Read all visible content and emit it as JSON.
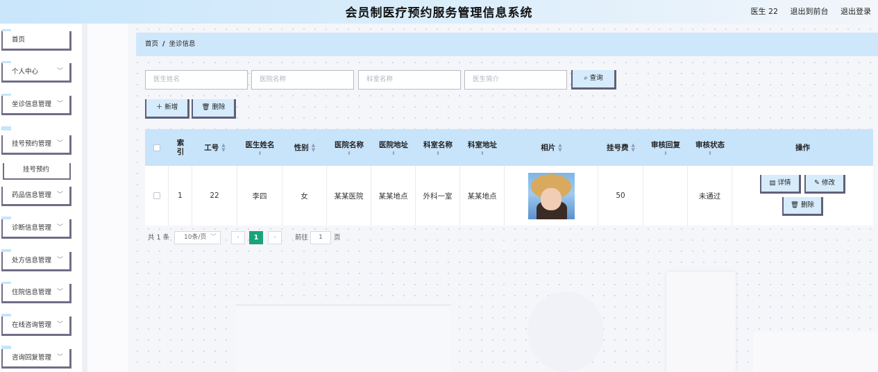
{
  "header": {
    "title": "会员制医疗预约服务管理信息系统",
    "user": "医生 22",
    "back_to_front": "退出到前台",
    "logout": "退出登录"
  },
  "sidebar": {
    "items": [
      {
        "label": "首页"
      },
      {
        "label": "个人中心"
      },
      {
        "label": "坐诊信息管理"
      },
      {
        "label": "挂号预约管理"
      },
      {
        "label": "药品信息管理"
      },
      {
        "label": "诊断信息管理"
      },
      {
        "label": "处方信息管理"
      },
      {
        "label": "住院信息管理"
      },
      {
        "label": "在线咨询管理"
      },
      {
        "label": "咨询回复管理"
      }
    ],
    "subitem": "挂号预约"
  },
  "breadcrumb": {
    "home": "首页",
    "separator": "/",
    "current": "坐诊信息"
  },
  "search": {
    "doctor_name_placeholder": "医生姓名",
    "hospital_name_placeholder": "医院名称",
    "department_name_placeholder": "科室名称",
    "doctor_intro_placeholder": "医生简介",
    "query_label": "查询"
  },
  "actions": {
    "add_label": "新增",
    "delete_label": "删除"
  },
  "table": {
    "headers": {
      "index": "索\n引",
      "job_no": "工号",
      "doctor_name": "医生姓名",
      "gender": "性别",
      "hospital_name": "医院名称",
      "hospital_address": "医院地址",
      "department_name": "科室名称",
      "department_address": "科室地址",
      "photo": "相片",
      "fee": "挂号费",
      "review_reply": "审核回复",
      "review_status": "审核状态",
      "operations": "操作"
    },
    "rows": [
      {
        "index": "1",
        "job_no": "22",
        "doctor_name": "李四",
        "gender": "女",
        "hospital_name": "某某医院",
        "hospital_address": "某某地点",
        "department_name": "外科一室",
        "department_address": "某某地点",
        "fee": "50",
        "review_reply": "",
        "review_status": "未通过"
      }
    ],
    "row_actions": {
      "detail": "详情",
      "edit": "修改",
      "delete": "删除"
    }
  },
  "pagination": {
    "total": "共 1 条",
    "page_size": "10条/页",
    "current_page": "1",
    "goto_label": "前往",
    "goto_value": "1",
    "page_unit": "页"
  },
  "colors": {
    "accent": "#c8e4fb",
    "border_dark": "#5f6079",
    "active_page": "#1aa37a"
  }
}
